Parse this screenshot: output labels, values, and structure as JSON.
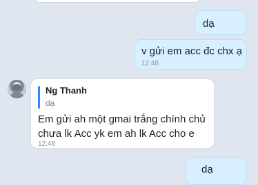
{
  "conversation": {
    "messages": [
      {
        "text": "dạ",
        "time": ""
      },
      {
        "text": "v gửi em acc đc chx ạ",
        "time": "12:48"
      },
      {
        "sender": "Ng Thanh",
        "quote_text": "dạ",
        "lines": [
          "Em gửi ah một gmai trắng chính chủ",
          "chưa lk Acc yk em ah lk Acc cho e"
        ],
        "time": "12:48"
      },
      {
        "text": "dạ",
        "time": ""
      }
    ]
  },
  "colors": {
    "background": "#dfe6ef",
    "outgoing_bubble": "#d8efff",
    "incoming_bubble": "#ffffff",
    "quote_accent": "#2d8cff",
    "meta_text": "#8a949c"
  },
  "icons": {
    "avatar": "profile-avatar"
  }
}
